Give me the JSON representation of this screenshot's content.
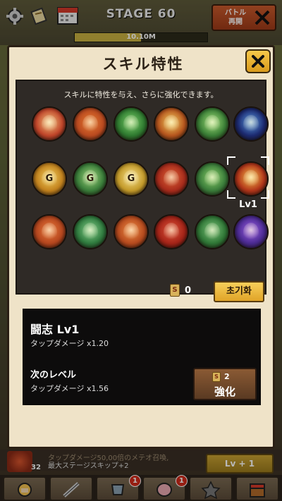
{
  "header": {
    "stage_title": "STAGE 60",
    "hp_text": "10.10M",
    "hp_fraction": 0.5,
    "battle_label_1": "バトル",
    "battle_label_2": "再開"
  },
  "modal": {
    "title": "スキル特性",
    "subtitle": "スキルに特性を与え、さらに強化できます。",
    "selected_level_label": "Lv1",
    "points_icon_text": "S",
    "points_value": "0",
    "reset_label": "초기화"
  },
  "skills": [
    {
      "name": "skill-1",
      "color": "#c0452a",
      "core": "#f3c27a",
      "glyph": ""
    },
    {
      "name": "skill-2",
      "color": "#b94a20",
      "core": "#e87a30",
      "glyph": ""
    },
    {
      "name": "skill-3",
      "color": "#2f7a30",
      "core": "#7bd06a",
      "glyph": ""
    },
    {
      "name": "skill-4",
      "color": "#b6561e",
      "core": "#f4d060",
      "glyph": ""
    },
    {
      "name": "skill-5",
      "color": "#3a7e36",
      "core": "#a2e07a",
      "glyph": ""
    },
    {
      "name": "skill-6",
      "color": "#1c2a70",
      "core": "#5a9ae0",
      "glyph": ""
    },
    {
      "name": "skill-7",
      "color": "#c2821e",
      "core": "#f3cf5e",
      "glyph": "G"
    },
    {
      "name": "skill-8",
      "color": "#3a7d3a",
      "core": "#9ed47a",
      "glyph": "G"
    },
    {
      "name": "skill-9",
      "color": "#c39a2a",
      "core": "#f7e08a",
      "glyph": "G"
    },
    {
      "name": "skill-10",
      "color": "#a82c1c",
      "core": "#e06436",
      "glyph": ""
    },
    {
      "name": "skill-11",
      "color": "#3a7c3a",
      "core": "#8cd06a",
      "glyph": ""
    },
    {
      "name": "skill-12",
      "color": "#b2361a",
      "core": "#f6c04a",
      "glyph": ""
    },
    {
      "name": "skill-13",
      "color": "#b4461e",
      "core": "#ec7a3c",
      "glyph": ""
    },
    {
      "name": "skill-14",
      "color": "#2f7a3e",
      "core": "#86d08a",
      "glyph": ""
    },
    {
      "name": "skill-15",
      "color": "#b54a1e",
      "core": "#f08c44",
      "glyph": ""
    },
    {
      "name": "skill-16",
      "color": "#a42418",
      "core": "#e0543a",
      "glyph": ""
    },
    {
      "name": "skill-17",
      "color": "#2f7636",
      "core": "#7dc47a",
      "glyph": ""
    },
    {
      "name": "skill-18",
      "color": "#4a2a90",
      "core": "#a060e8",
      "glyph": ""
    }
  ],
  "detail": {
    "name": "闘志 Lv1",
    "current_effect": "タップダメージ x1.20",
    "next_label": "次のレベル",
    "next_effect": "タップダメージ x1.56",
    "upgrade_cost_icon": "S",
    "upgrade_cost": "2",
    "upgrade_label": "強化"
  },
  "bottom": {
    "avatar_count": "32",
    "desc_line1": "タップダメージ50,00倍のメテオ召喚,",
    "desc_line2": "最大ステージスキップ+2",
    "lv_plus_label": "Lv + 1"
  },
  "tabs": [
    {
      "name": "tab-hero",
      "badge": ""
    },
    {
      "name": "tab-weapon",
      "badge": ""
    },
    {
      "name": "tab-companion",
      "badge": "1"
    },
    {
      "name": "tab-pet",
      "badge": "1"
    },
    {
      "name": "tab-artifact",
      "badge": ""
    },
    {
      "name": "tab-shop",
      "badge": ""
    }
  ],
  "colors": {
    "modal_bg": "#efe3c8",
    "panel_dark": "#2f2a26",
    "button_gold": "#f0b83a",
    "button_brown": "#6e4a2c"
  }
}
